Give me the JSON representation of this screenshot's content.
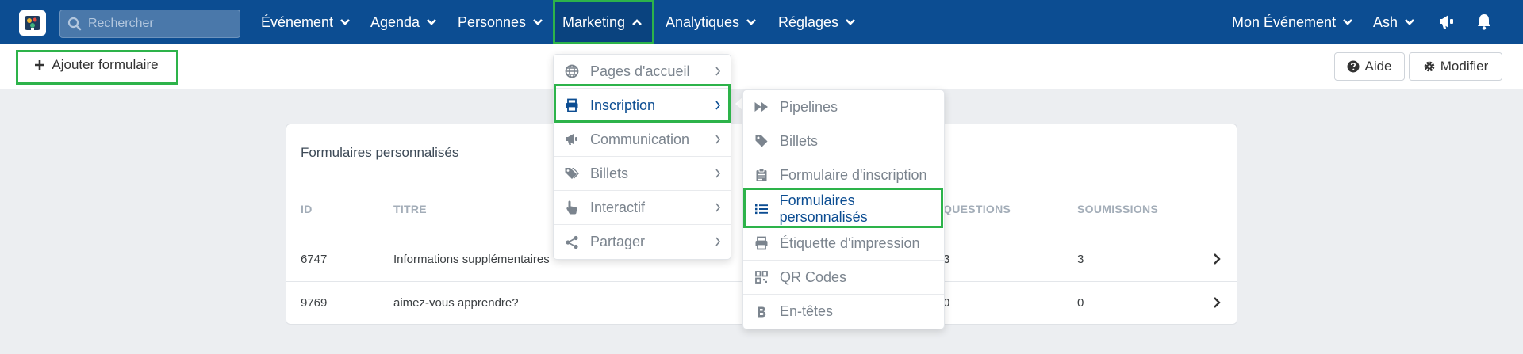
{
  "nav": {
    "search_placeholder": "Rechercher",
    "items": [
      {
        "label": "Événement"
      },
      {
        "label": "Agenda"
      },
      {
        "label": "Personnes"
      },
      {
        "label": "Marketing"
      },
      {
        "label": "Analytiques"
      },
      {
        "label": "Réglages"
      }
    ],
    "event_menu": "Mon Événement",
    "user": "Ash"
  },
  "toolbar": {
    "add_form_label": "Ajouter formulaire",
    "help_label": "Aide",
    "edit_label": "Modifier"
  },
  "card": {
    "title": "Formulaires personnalisés",
    "columns": [
      "ID",
      "TITRE",
      "QUESTIONS",
      "SOUMISSIONS"
    ],
    "rows": [
      {
        "id": "6747",
        "title": "Informations supplémentaires",
        "questions": "3",
        "submissions": "3"
      },
      {
        "id": "9769",
        "title": "aimez-vous apprendre?",
        "questions": "0",
        "submissions": "0"
      }
    ]
  },
  "marketing_menu": {
    "items": [
      {
        "label": "Pages d'accueil",
        "icon": "globe-icon"
      },
      {
        "label": "Inscription",
        "icon": "printer-icon"
      },
      {
        "label": "Communication",
        "icon": "megaphone-icon"
      },
      {
        "label": "Billets",
        "icon": "tags-icon"
      },
      {
        "label": "Interactif",
        "icon": "hand-pointer-icon"
      },
      {
        "label": "Partager",
        "icon": "share-icon"
      }
    ]
  },
  "inscription_menu": {
    "items": [
      {
        "label": "Pipelines",
        "icon": "fast-forward-icon"
      },
      {
        "label": "Billets",
        "icon": "tag-icon"
      },
      {
        "label": "Formulaire d'inscription",
        "icon": "clipboard-icon"
      },
      {
        "label": "Formulaires personnalisés",
        "icon": "list-icon"
      },
      {
        "label": "Étiquette d'impression",
        "icon": "printer-icon"
      },
      {
        "label": "QR Codes",
        "icon": "qrcode-icon"
      },
      {
        "label": "En-têtes",
        "icon": "bold-icon"
      }
    ]
  },
  "colors": {
    "nav_bg": "#0c4d92",
    "highlight": "#2db34a",
    "active_text": "#0c4d92"
  }
}
